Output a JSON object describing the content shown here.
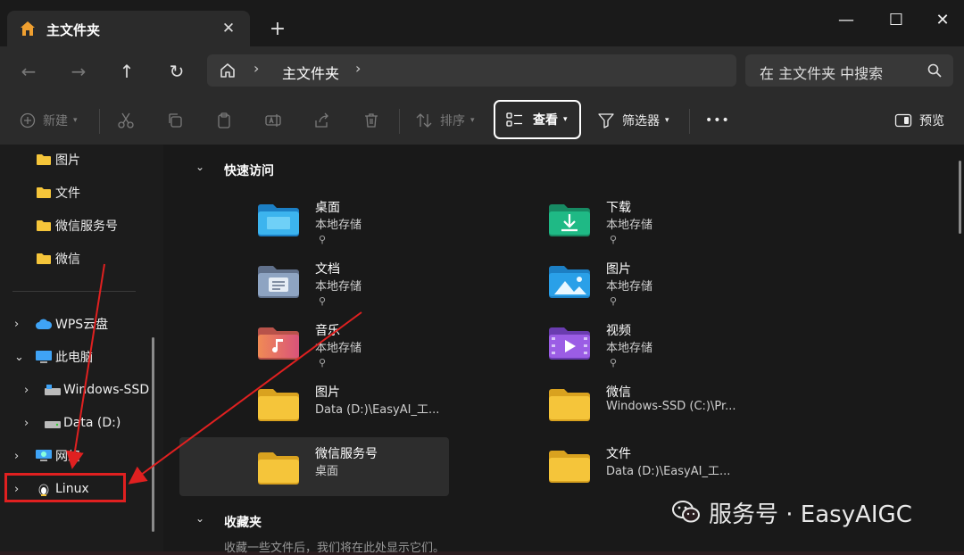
{
  "tab": {
    "title": "主文件夹",
    "close": "✕",
    "new": "+"
  },
  "window_controls": {
    "minimize": "—",
    "maximize": "☐",
    "close": "✕"
  },
  "nav": {
    "back": "←",
    "forward": "→",
    "up": "↑",
    "refresh": "↻"
  },
  "address": {
    "crumb": "主文件夹",
    "sep": "›"
  },
  "search": {
    "placeholder": "在 主文件夹 中搜索"
  },
  "toolbar": {
    "new_label": "新建",
    "sort_label": "排序",
    "view_label": "查看",
    "filter_label": "筛选器",
    "more_label": "•••",
    "preview_label": "预览"
  },
  "sidebar": {
    "items": [
      {
        "label": "图片"
      },
      {
        "label": "文件"
      },
      {
        "label": "微信服务号"
      },
      {
        "label": "微信"
      },
      {
        "label": "WPS云盘"
      },
      {
        "label": "此电脑"
      },
      {
        "label": "Windows-SSD"
      },
      {
        "label": "Data (D:)"
      },
      {
        "label": "网络"
      },
      {
        "label": "Linux"
      }
    ]
  },
  "quick_access": {
    "title": "快速访问",
    "items": [
      {
        "name": "桌面",
        "sub": "本地存储",
        "icon": "desktop-folder-icon",
        "pinned": true
      },
      {
        "name": "下载",
        "sub": "本地存储",
        "icon": "downloads-folder-icon",
        "pinned": true
      },
      {
        "name": "文档",
        "sub": "本地存储",
        "icon": "documents-folder-icon",
        "pinned": true
      },
      {
        "name": "图片",
        "sub": "本地存储",
        "icon": "pictures-folder-icon",
        "pinned": true
      },
      {
        "name": "音乐",
        "sub": "本地存储",
        "icon": "music-folder-icon",
        "pinned": true
      },
      {
        "name": "视频",
        "sub": "本地存储",
        "icon": "videos-folder-icon",
        "pinned": true
      },
      {
        "name": "图片",
        "sub": "Data (D:)\\EasyAI_工...",
        "icon": "folder-icon",
        "pinned": false
      },
      {
        "name": "微信",
        "sub": "Windows-SSD (C:)\\Pr...",
        "icon": "folder-icon",
        "pinned": false
      },
      {
        "name": "微信服务号",
        "sub": "桌面",
        "icon": "folder-icon",
        "pinned": false
      },
      {
        "name": "文件",
        "sub": "Data (D:)\\EasyAI_工...",
        "icon": "folder-icon",
        "pinned": false
      }
    ]
  },
  "favorites": {
    "title": "收藏夹",
    "hint": "收藏一些文件后，我们将在此处显示它们。"
  },
  "watermark": {
    "text": "服务号 · EasyAIGC"
  },
  "pin_glyph": "⚲",
  "colors": {
    "accent": "#4cc2ff",
    "annotation": "#e02020",
    "folder": "#f5c53a"
  }
}
